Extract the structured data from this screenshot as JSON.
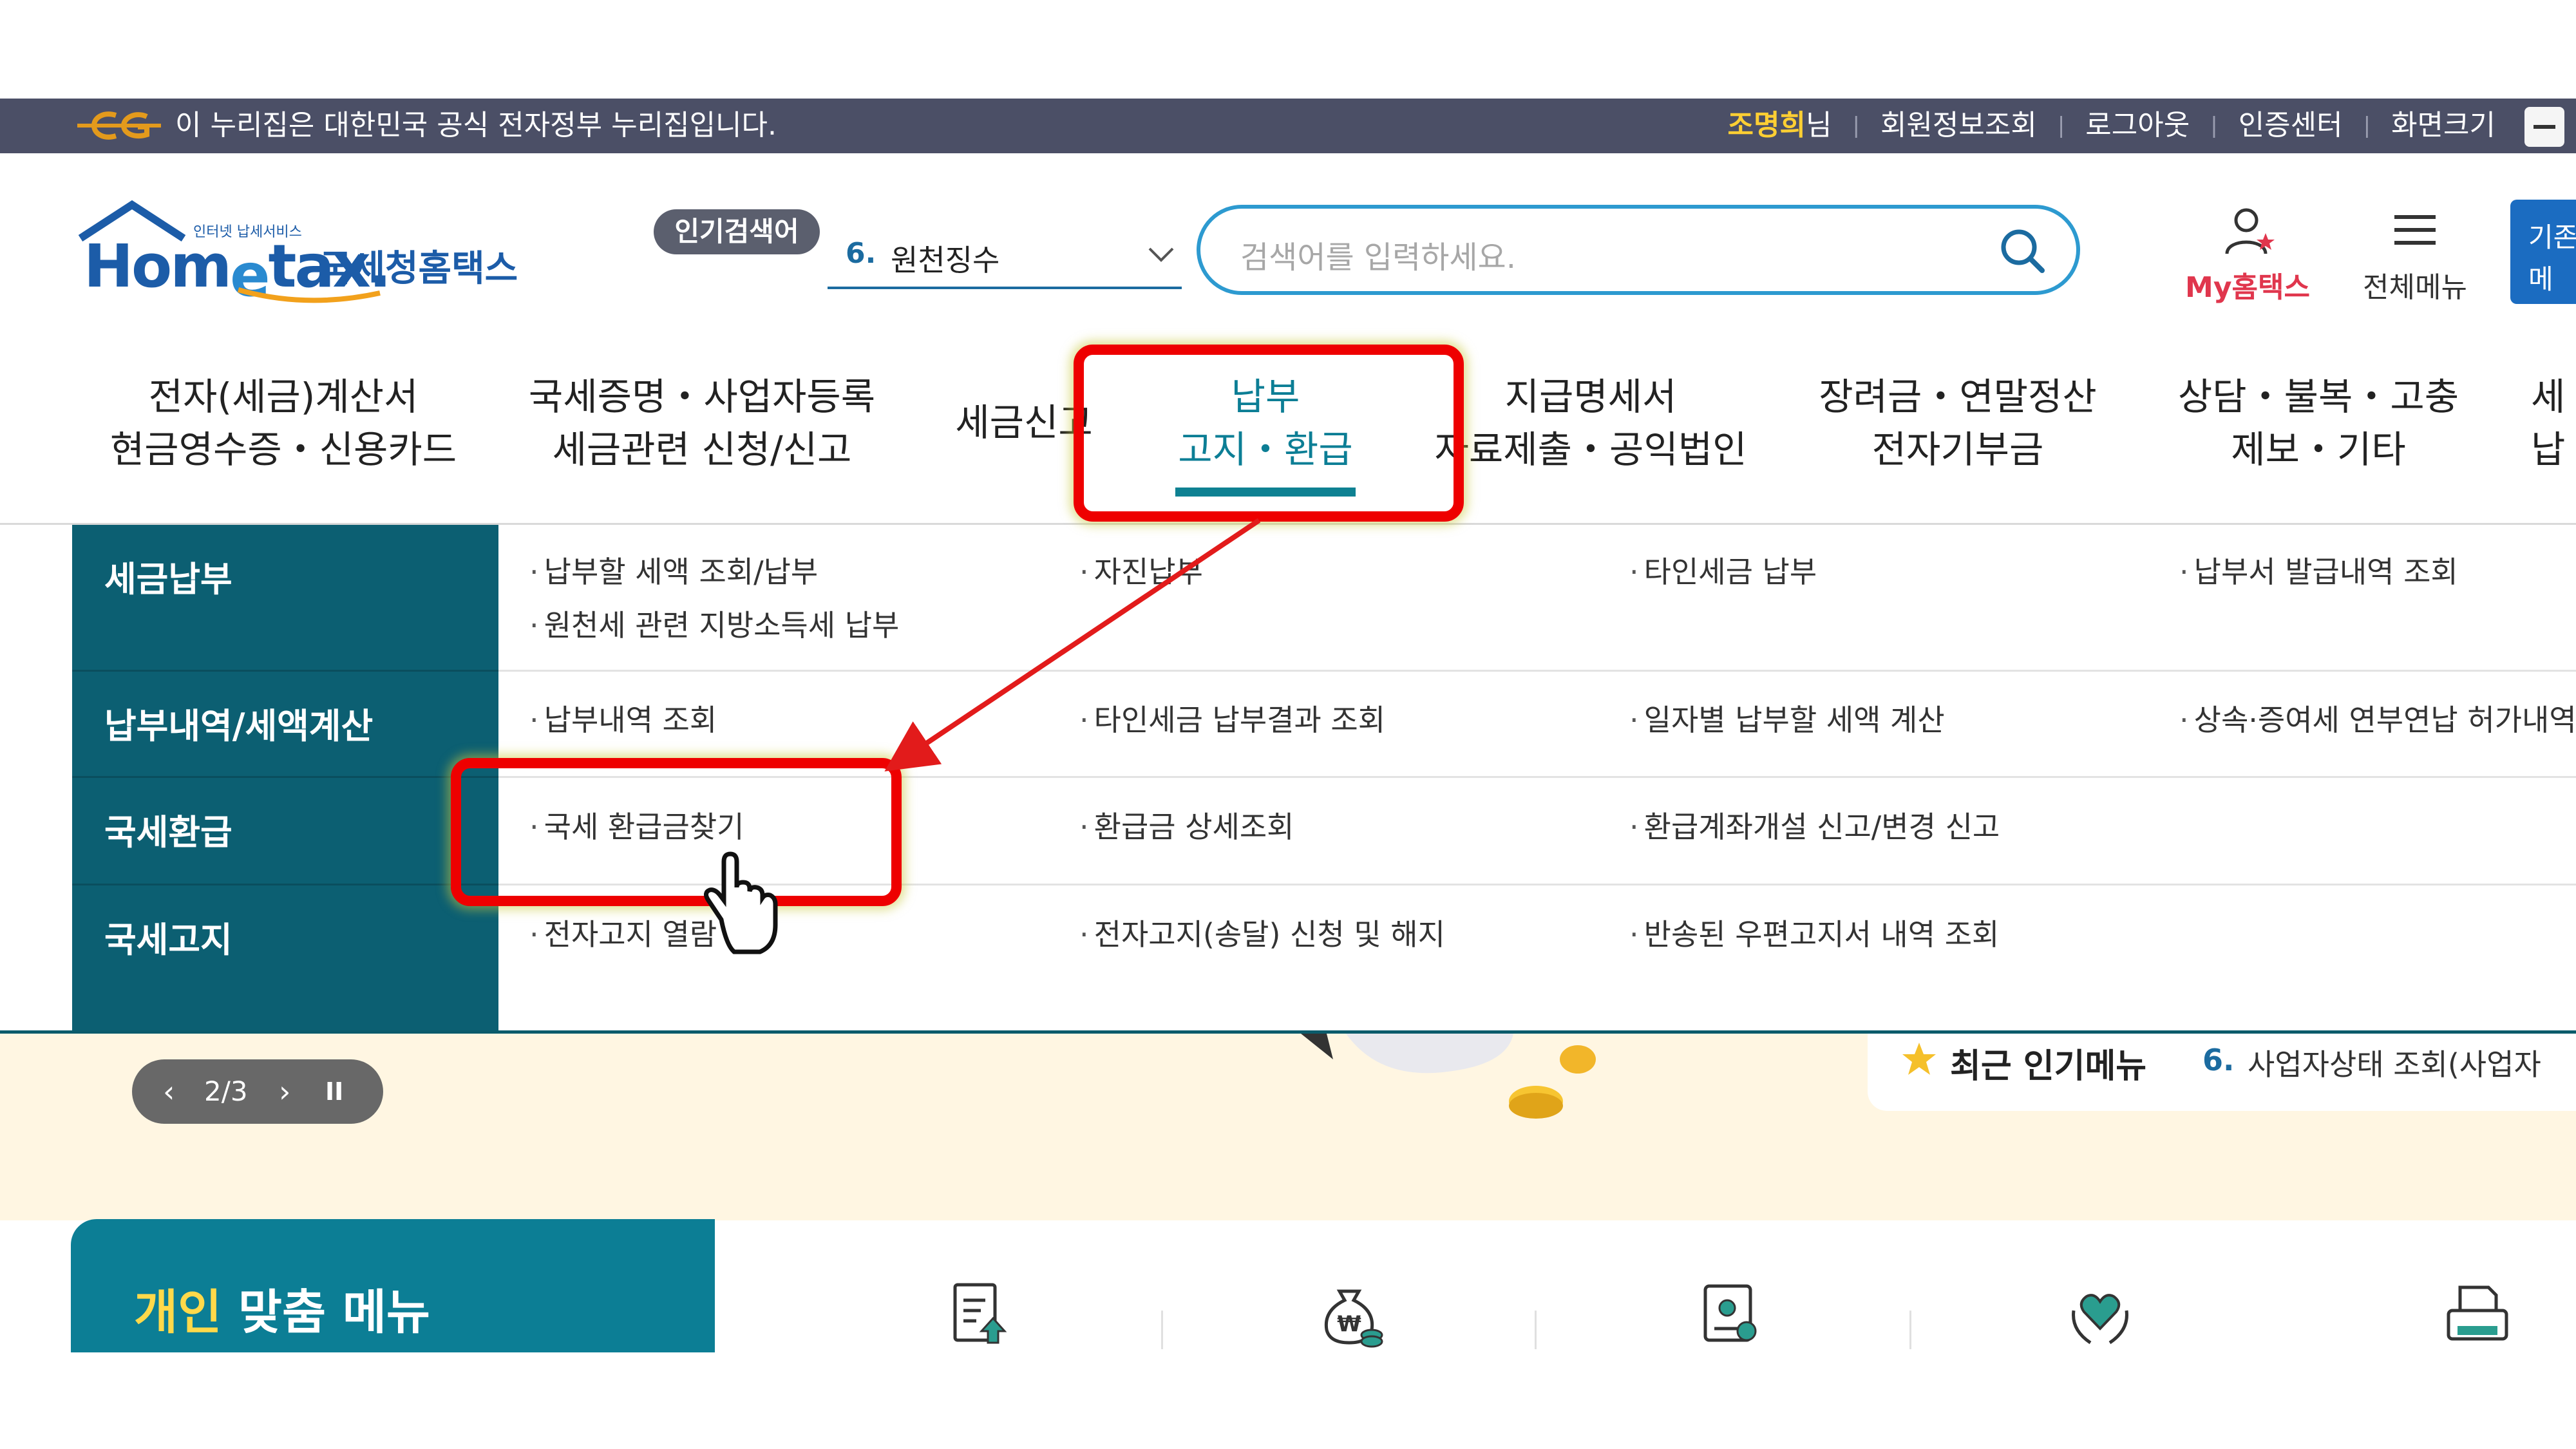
{
  "colors": {
    "gov_bar": "#4b4f66",
    "brand_teal": "#0c7e95",
    "menu_side": "#0c5f72",
    "search_border": "#2d9ad0",
    "annotation_red": "#ee0000",
    "my_hometax": "#e0364d",
    "lower_bg": "#fff6e2"
  },
  "gov_bar": {
    "notice": "이 누리집은 대한민국 공식 전자정부 누리집입니다.",
    "user_name": "조명희",
    "user_suffix": "님",
    "links": [
      "회원정보조회",
      "로그아웃",
      "인증센터",
      "화면크기"
    ],
    "zoom_icon": "minus-icon"
  },
  "header": {
    "logo_small": "인터넷 납세서비스",
    "logo_main_1": "Hom",
    "logo_main_2": "e",
    "logo_main_3": "tax.",
    "logo_korean": "국세청홈택스",
    "popular_label": "인기검색어",
    "popular_rank": "6.",
    "popular_term": "원천징수",
    "search_placeholder": "검색어를 입력하세요.",
    "my_hometax": "My홈택스",
    "all_menu": "전체메뉴",
    "base_menu_1": "기존",
    "base_menu_2": "메"
  },
  "gnb": [
    {
      "line1": "전자(세금)계산서",
      "line2": "현금영수증・신용카드"
    },
    {
      "line1": "국세증명・사업자등록",
      "line2": "세금관련 신청/신고"
    },
    {
      "line1": "세금신고",
      "line2": ""
    },
    {
      "line1": "납부",
      "line2": "고지・환급"
    },
    {
      "line1": "지급명세서",
      "line2": "자료제출・공익법인"
    },
    {
      "line1": "장려금・연말정산",
      "line2": "전자기부금"
    },
    {
      "line1": "상담・불복・고충",
      "line2": "제보・기타"
    },
    {
      "line1": "세",
      "line2": "납"
    }
  ],
  "mega_menu": {
    "sections": [
      {
        "title": "세금납부",
        "items": [
          "납부할 세액 조회/납부",
          "원천세 관련 지방소득세 납부",
          "자진납부",
          "타인세금 납부",
          "납부서 발급내역 조회"
        ]
      },
      {
        "title": "납부내역/세액계산",
        "items": [
          "납부내역 조회",
          "타인세금 납부결과 조회",
          "일자별 납부할 세액 계산",
          "상속·증여세 연부연납 허가내역"
        ]
      },
      {
        "title": "국세환급",
        "items": [
          "국세 환급금찾기",
          "환급금 상세조회",
          "환급계좌개설 신고/변경 신고"
        ]
      },
      {
        "title": "국세고지",
        "items": [
          "전자고지 열람",
          "전자고지(송달) 신청 및 해지",
          "반송된 우편고지서 내역 조회"
        ]
      }
    ]
  },
  "slider": {
    "prev": "‹",
    "page": "2/3",
    "next": "›",
    "pause": "II",
    "current": 2,
    "total": 3
  },
  "recent": {
    "label": "최근 인기메뉴",
    "rank": "6.",
    "item": "사업자상태 조회(사업자"
  },
  "personal": {
    "title_hl": "개인",
    "title_rest": " 맞춤 메뉴",
    "icons": [
      "document-upload-icon",
      "money-bag-icon",
      "certificate-icon",
      "heart-hands-icon",
      "printer-icon"
    ]
  }
}
